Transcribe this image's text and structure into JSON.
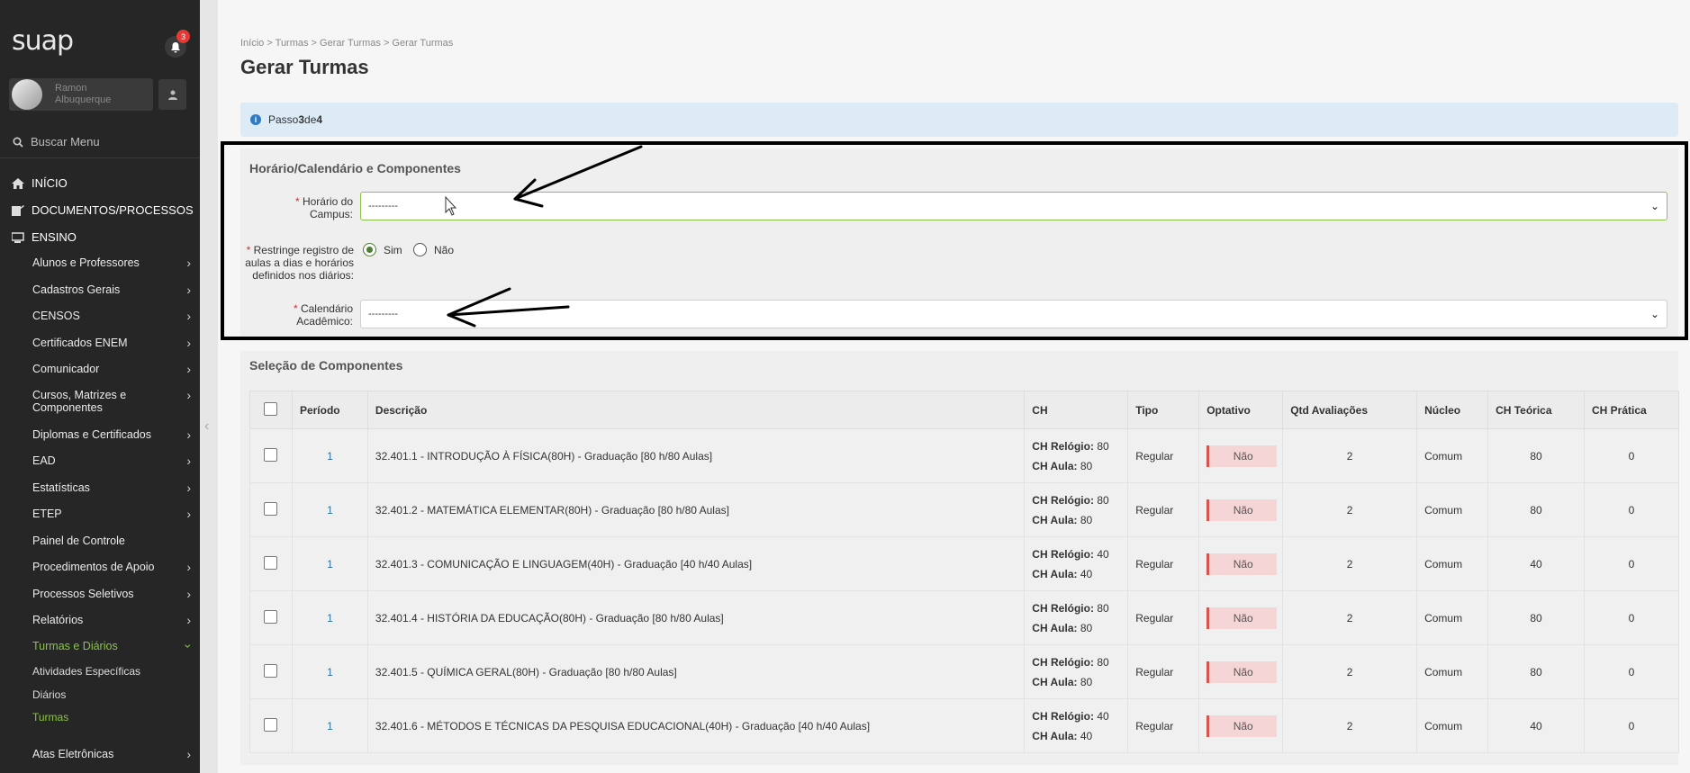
{
  "sidebar": {
    "logo": "suap",
    "notifications": "3",
    "user_name": "Ramon Albuquerque",
    "search_label": "Buscar Menu",
    "top_items": [
      {
        "label": "INÍCIO",
        "icon": "home-icon"
      },
      {
        "label": "DOCUMENTOS/PROCESSOS",
        "icon": "document-icon"
      },
      {
        "label": "ENSINO",
        "icon": "ensino-icon"
      }
    ],
    "ensino_items": [
      "Alunos e Professores",
      "Cadastros Gerais",
      "CENSOS",
      "Certificados ENEM",
      "Comunicador",
      "Cursos, Matrizes e Componentes",
      "Diplomas e Certificados",
      "EAD",
      "Estatísticas",
      "ETEP",
      "Painel de Controle",
      "Procedimentos de Apoio",
      "Processos Seletivos",
      "Relatórios",
      "Turmas e Diários"
    ],
    "sub_items": [
      "Atividades Específicas",
      "Diários",
      "Turmas"
    ],
    "last_item": "Atas Eletrônicas"
  },
  "main": {
    "breadcrumb": "Início > Turmas > Gerar Turmas > Gerar Turmas",
    "title": "Gerar Turmas",
    "step": {
      "prefix": "Passo ",
      "current": "3",
      "middle": " de ",
      "total": "4"
    },
    "section1": {
      "title": "Horário/Calendário e Componentes",
      "horario_label": "Horário do Campus:",
      "horario_value": "---------",
      "restringe_label_1": "Restringe registro de",
      "restringe_label_2": "aulas a dias e horários",
      "restringe_label_3": "definidos nos diários:",
      "radio_yes": "Sim",
      "radio_no": "Não",
      "calendario_label_1": "Calendário",
      "calendario_label_2": "Acadêmico:",
      "calendario_value": "---------"
    },
    "section2": {
      "title": "Seleção de Componentes",
      "columns": [
        "Período",
        "Descrição",
        "CH",
        "Tipo",
        "Optativo",
        "Qtd Avaliações",
        "Núcleo",
        "CH Teórica",
        "CH Prática"
      ],
      "ch_relogio_label": "CH Relógio:",
      "ch_aula_label": "CH Aula:",
      "rows": [
        {
          "periodo": "1",
          "descricao": "32.401.1 - INTRODUÇÃO À FÍSICA(80H) - Graduação [80 h/80 Aulas]",
          "relogio": "80",
          "aula": "80",
          "tipo": "Regular",
          "optativo": "Não",
          "qtd": "2",
          "nucleo": "Comum",
          "teorica": "80",
          "pratica": "0"
        },
        {
          "periodo": "1",
          "descricao": "32.401.2 - MATEMÁTICA ELEMENTAR(80H) - Graduação [80 h/80 Aulas]",
          "relogio": "80",
          "aula": "80",
          "tipo": "Regular",
          "optativo": "Não",
          "qtd": "2",
          "nucleo": "Comum",
          "teorica": "80",
          "pratica": "0"
        },
        {
          "periodo": "1",
          "descricao": "32.401.3 - COMUNICAÇÃO E LINGUAGEM(40H) - Graduação [40 h/40 Aulas]",
          "relogio": "40",
          "aula": "40",
          "tipo": "Regular",
          "optativo": "Não",
          "qtd": "2",
          "nucleo": "Comum",
          "teorica": "40",
          "pratica": "0"
        },
        {
          "periodo": "1",
          "descricao": "32.401.4 - HISTÓRIA DA EDUCAÇÃO(80H) - Graduação [80 h/80 Aulas]",
          "relogio": "80",
          "aula": "80",
          "tipo": "Regular",
          "optativo": "Não",
          "qtd": "2",
          "nucleo": "Comum",
          "teorica": "80",
          "pratica": "0"
        },
        {
          "periodo": "1",
          "descricao": "32.401.5 - QUÍMICA GERAL(80H) - Graduação [80 h/80 Aulas]",
          "relogio": "80",
          "aula": "80",
          "tipo": "Regular",
          "optativo": "Não",
          "qtd": "2",
          "nucleo": "Comum",
          "teorica": "80",
          "pratica": "0"
        },
        {
          "periodo": "1",
          "descricao": "32.401.6 - MÉTODOS E TÉCNICAS DA PESQUISA EDUCACIONAL(40H) - Graduação [40 h/40 Aulas]",
          "relogio": "40",
          "aula": "40",
          "tipo": "Regular",
          "optativo": "Não",
          "qtd": "2",
          "nucleo": "Comum",
          "teorica": "40",
          "pratica": "0"
        }
      ]
    }
  },
  "colors": {
    "accent_green": "#8bc34a",
    "sidebar_bg": "#262626",
    "danger": "#d9534f",
    "info": "#2e7bc4"
  }
}
